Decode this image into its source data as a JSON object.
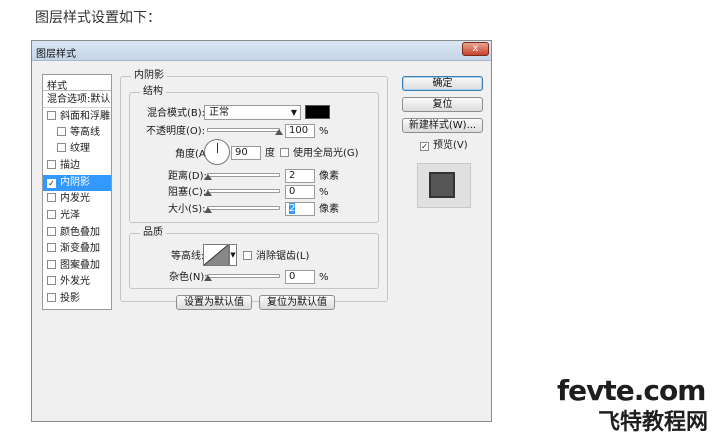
{
  "intro_text": "图层样式设置如下：",
  "window": {
    "title": "图层样式",
    "close_glyph": "x"
  },
  "styles_panel": {
    "header": "样式",
    "blend_item": "混合选项:默认",
    "items": [
      {
        "label": "斜面和浮雕",
        "checked": false
      },
      {
        "label": "等高线",
        "checked": false,
        "sub": true
      },
      {
        "label": "纹理",
        "checked": false,
        "sub": true
      },
      {
        "label": "描边",
        "checked": false
      },
      {
        "label": "内阴影",
        "checked": true,
        "selected": true
      },
      {
        "label": "内发光",
        "checked": false
      },
      {
        "label": "光泽",
        "checked": false
      },
      {
        "label": "颜色叠加",
        "checked": false
      },
      {
        "label": "渐变叠加",
        "checked": false
      },
      {
        "label": "图案叠加",
        "checked": false
      },
      {
        "label": "外发光",
        "checked": false
      },
      {
        "label": "投影",
        "checked": false
      }
    ]
  },
  "inner_shadow": {
    "title": "内阴影",
    "structure": {
      "title": "结构",
      "blend_mode_label": "混合模式(B):",
      "blend_mode_value": "正常",
      "shadow_color": "#000000",
      "opacity_label": "不透明度(O):",
      "opacity_value": "100",
      "opacity_unit": "%",
      "angle_label": "角度(A):",
      "angle_value": "90",
      "angle_unit": "度",
      "global_light_label": "使用全局光(G)",
      "global_light_checked": false,
      "distance_label": "距离(D):",
      "distance_value": "2",
      "distance_unit": "像素",
      "choke_label": "阻塞(C):",
      "choke_value": "0",
      "choke_unit": "%",
      "size_label": "大小(S):",
      "size_value": "2",
      "size_unit": "像素"
    },
    "quality": {
      "title": "品质",
      "contour_label": "等高线:",
      "antialias_label": "消除锯齿(L)",
      "antialias_checked": false,
      "noise_label": "杂色(N):",
      "noise_value": "0",
      "noise_unit": "%"
    },
    "make_default_btn": "设置为默认值",
    "reset_default_btn": "复位为默认值"
  },
  "right_buttons": {
    "ok": "确定",
    "reset": "复位",
    "new_style": "新建样式(W)...",
    "preview_label": "预览(V)",
    "preview_checked": true
  },
  "watermark": {
    "line1": "fevte.com",
    "line2": "飞特教程网"
  }
}
